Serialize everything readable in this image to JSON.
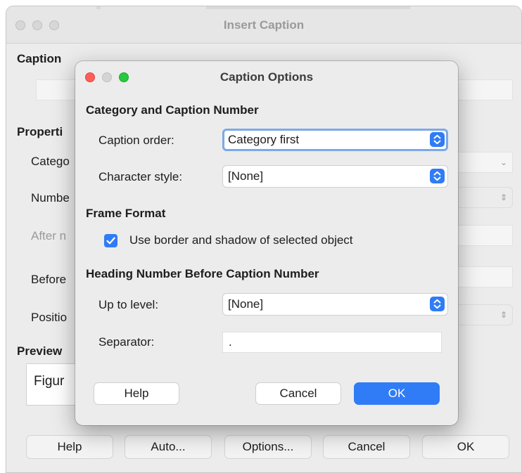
{
  "background_dialog": {
    "title": "Insert Caption",
    "caption_heading": "Caption",
    "properties_heading": "Properti",
    "category_label": "Catego",
    "numbering_label": "Numbe",
    "after_number_label": "After n",
    "before_label": "Before",
    "position_label": "Positio",
    "preview_heading": "Preview",
    "preview_text": "Figur",
    "buttons": {
      "help": "Help",
      "auto": "Auto...",
      "options": "Options...",
      "cancel": "Cancel",
      "ok": "OK"
    }
  },
  "caption_options": {
    "title": "Caption Options",
    "category_section": "Category and Caption Number",
    "caption_order_label": "Caption order:",
    "caption_order_value": "Category first",
    "character_style_label": "Character style:",
    "character_style_value": "[None]",
    "frame_format_section": "Frame Format",
    "use_border_label": "Use border and shadow of selected object",
    "use_border_checked": true,
    "heading_section": "Heading Number Before Caption Number",
    "up_to_level_label": "Up to level:",
    "up_to_level_value": "[None]",
    "separator_label": "Separator:",
    "separator_value": ".",
    "buttons": {
      "help": "Help",
      "cancel": "Cancel",
      "ok": "OK"
    }
  },
  "colors": {
    "accent": "#2f7cf6",
    "close_light": "#fe5f57",
    "minimize_light": "#d4d4d4",
    "zoom_light": "#28c840"
  },
  "icons": {
    "select_arrows": "chevron-up-down-icon",
    "checkbox": "checkmark-icon"
  }
}
